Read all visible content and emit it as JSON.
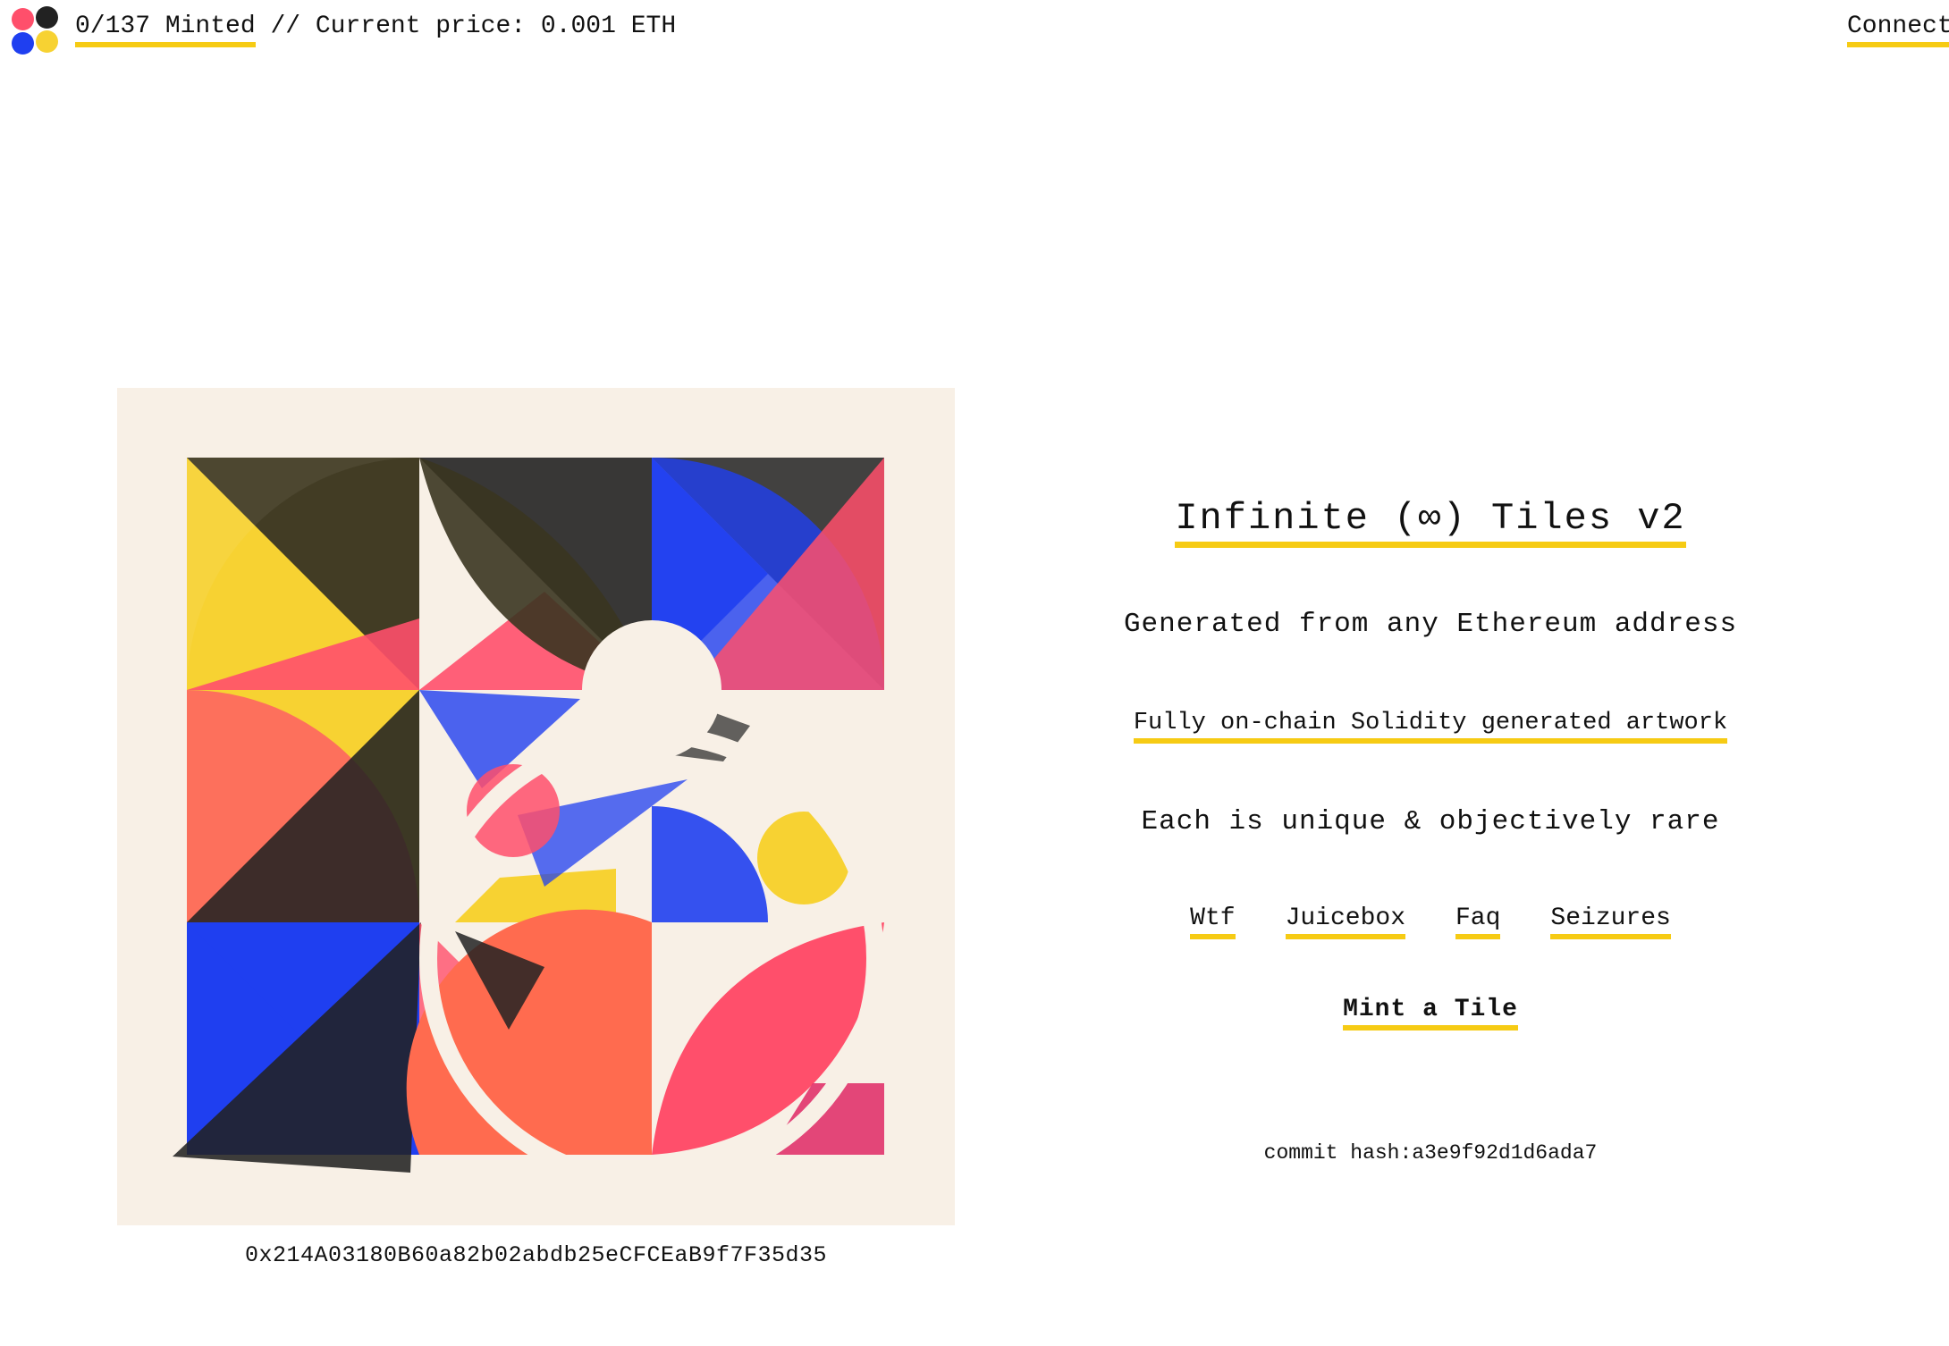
{
  "header": {
    "minted_label": "0/137 Minted",
    "price_text": " // Current price: 0.001 ETH",
    "connect_label": "Connect",
    "logo_colors": [
      "#ff4f6b",
      "#222222",
      "#1f3ff0",
      "#f7d232"
    ]
  },
  "artwork": {
    "icon": "generative-tile-artwork",
    "background": "#f8f0e6",
    "palette": [
      "#f7d232",
      "#ff4f6b",
      "#222222",
      "#1f3ff0"
    ]
  },
  "address": "0x214A03180B60a82b02abdb25eCFCEaB9f7F35d35",
  "panel": {
    "title": "Infinite (∞) Tiles v2",
    "line1": "Generated from any Ethereum address",
    "line2": "Fully on-chain Solidity generated artwork",
    "line3": "Each is unique & objectively rare",
    "links": [
      "Wtf",
      "Juicebox",
      "Faq",
      "Seizures"
    ],
    "mint_label": "Mint a Tile",
    "commit_text": "commit hash:a3e9f92d1d6ada7"
  },
  "colors": {
    "accent": "#f6cb14"
  }
}
